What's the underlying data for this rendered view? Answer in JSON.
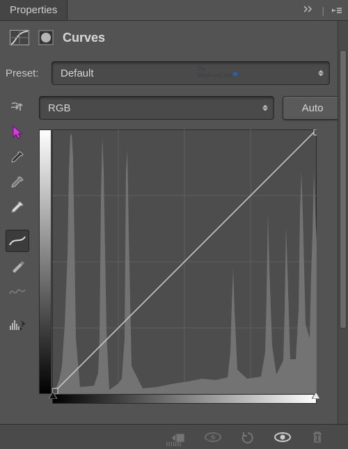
{
  "panel": {
    "title": "Properties"
  },
  "adjustment": {
    "title": "Curves"
  },
  "preset": {
    "label": "Preset:",
    "value": "Default"
  },
  "channel": {
    "value": "RGB"
  },
  "buttons": {
    "auto": "Auto"
  },
  "tools": {
    "targeted": "targeted-adjustment",
    "cursor": "pointer",
    "eyedropper_black": "black-point-eyedropper",
    "eyedropper_gray": "gray-point-eyedropper",
    "eyedropper_white": "white-point-eyedropper",
    "edit_points": "edit-points",
    "pencil": "draw-curve",
    "smooth": "smooth-curve",
    "histogram": "histogram-options"
  },
  "bottom": {
    "clip": "clip-to-layer",
    "view_prev": "view-previous",
    "reset": "reset",
    "visibility": "toggle-visibility",
    "delete": "delete"
  },
  "watermark": "WindowsClub"
}
